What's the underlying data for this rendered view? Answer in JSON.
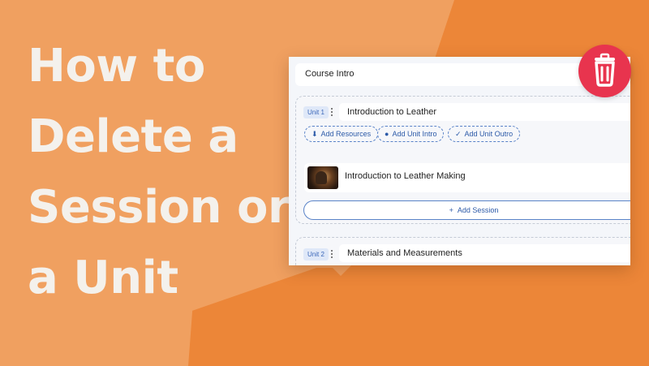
{
  "headline": {
    "lines": [
      "How to",
      "Delete a",
      "Session or",
      "a Unit"
    ]
  },
  "course": {
    "intro_label": "Course Intro",
    "units": [
      {
        "tag": "Unit 1",
        "title": "Introduction to Leather",
        "actions": [
          {
            "label": "Add Resources",
            "icon": "download-icon"
          },
          {
            "label": "Add Unit Intro",
            "icon": "camera-icon"
          },
          {
            "label": "Add Unit Outro",
            "icon": "check-icon"
          }
        ],
        "sessions": [
          {
            "title": "Introduction to Leather Making",
            "thumbnail": "leather-workshop-thumbnail"
          }
        ],
        "add_session_label": "Add Session"
      },
      {
        "tag": "Unit 2",
        "title": "Materials and Measurements"
      }
    ]
  },
  "trash": {
    "icon": "trash-icon"
  },
  "colors": {
    "background_light": "#f0a060",
    "background_dark": "#ec8638",
    "headline": "#f4f1ec",
    "accent_blue": "#2c5aa8",
    "trash_red": "#e8344e"
  }
}
